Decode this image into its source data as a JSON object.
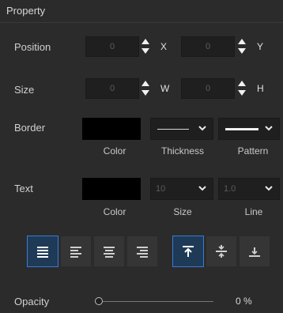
{
  "panel": {
    "title": "Property"
  },
  "position": {
    "label": "Position",
    "x_value": "0",
    "y_value": "0",
    "x_axis": "X",
    "y_axis": "Y"
  },
  "size": {
    "label": "Size",
    "w_value": "0",
    "h_value": "0",
    "w_axis": "W",
    "h_axis": "H"
  },
  "border": {
    "label": "Border",
    "color": "#000000",
    "color_label": "Color",
    "thickness_label": "Thickness",
    "pattern_label": "Pattern"
  },
  "text": {
    "label": "Text",
    "color": "#000000",
    "color_label": "Color",
    "size_value": "10",
    "size_label": "Size",
    "line_value": "1.0",
    "line_label": "Line"
  },
  "alignment": {
    "horizontal": [
      "justify",
      "left",
      "center",
      "right"
    ],
    "vertical": [
      "top",
      "middle",
      "bottom"
    ],
    "active_horizontal": "justify",
    "active_vertical": "top"
  },
  "opacity": {
    "label": "Opacity",
    "value": 0,
    "display": "0 %"
  },
  "colors": {
    "accent": "#3a7bd5",
    "panel_bg": "#2b2b2b",
    "field_bg": "#1f1f1f"
  }
}
